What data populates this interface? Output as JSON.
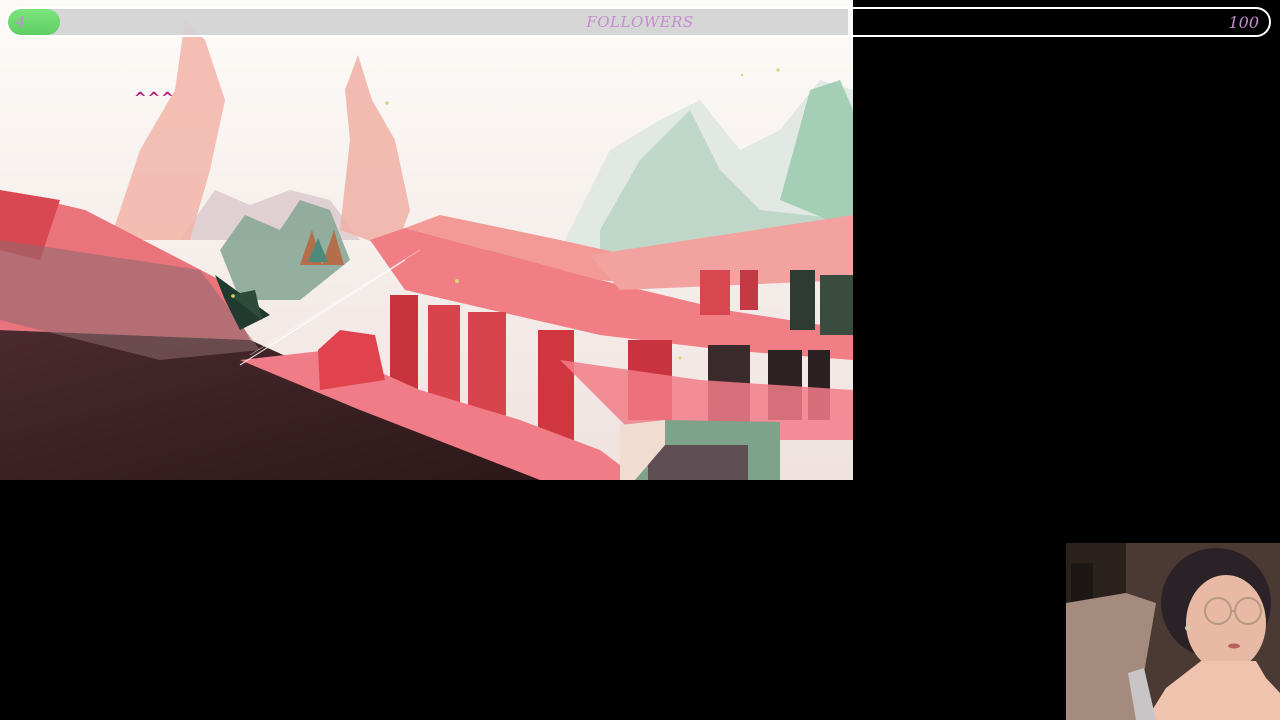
{
  "goal_bar": {
    "label": "FOLLOWERS",
    "current": "4",
    "target": "100",
    "progress": 0.04,
    "fill_color": "#5fcf63",
    "text_color": "#c58cd0"
  },
  "game": {
    "marker_text": "^^^",
    "marker_color": "#b4207a",
    "palette": {
      "sky": "#fbf7f3",
      "coral": "#f07a80",
      "red": "#d8474f",
      "dark": "#3a2226",
      "mint": "#9fc8ae"
    }
  },
  "webcam": {
    "icon": "streamer-face"
  }
}
